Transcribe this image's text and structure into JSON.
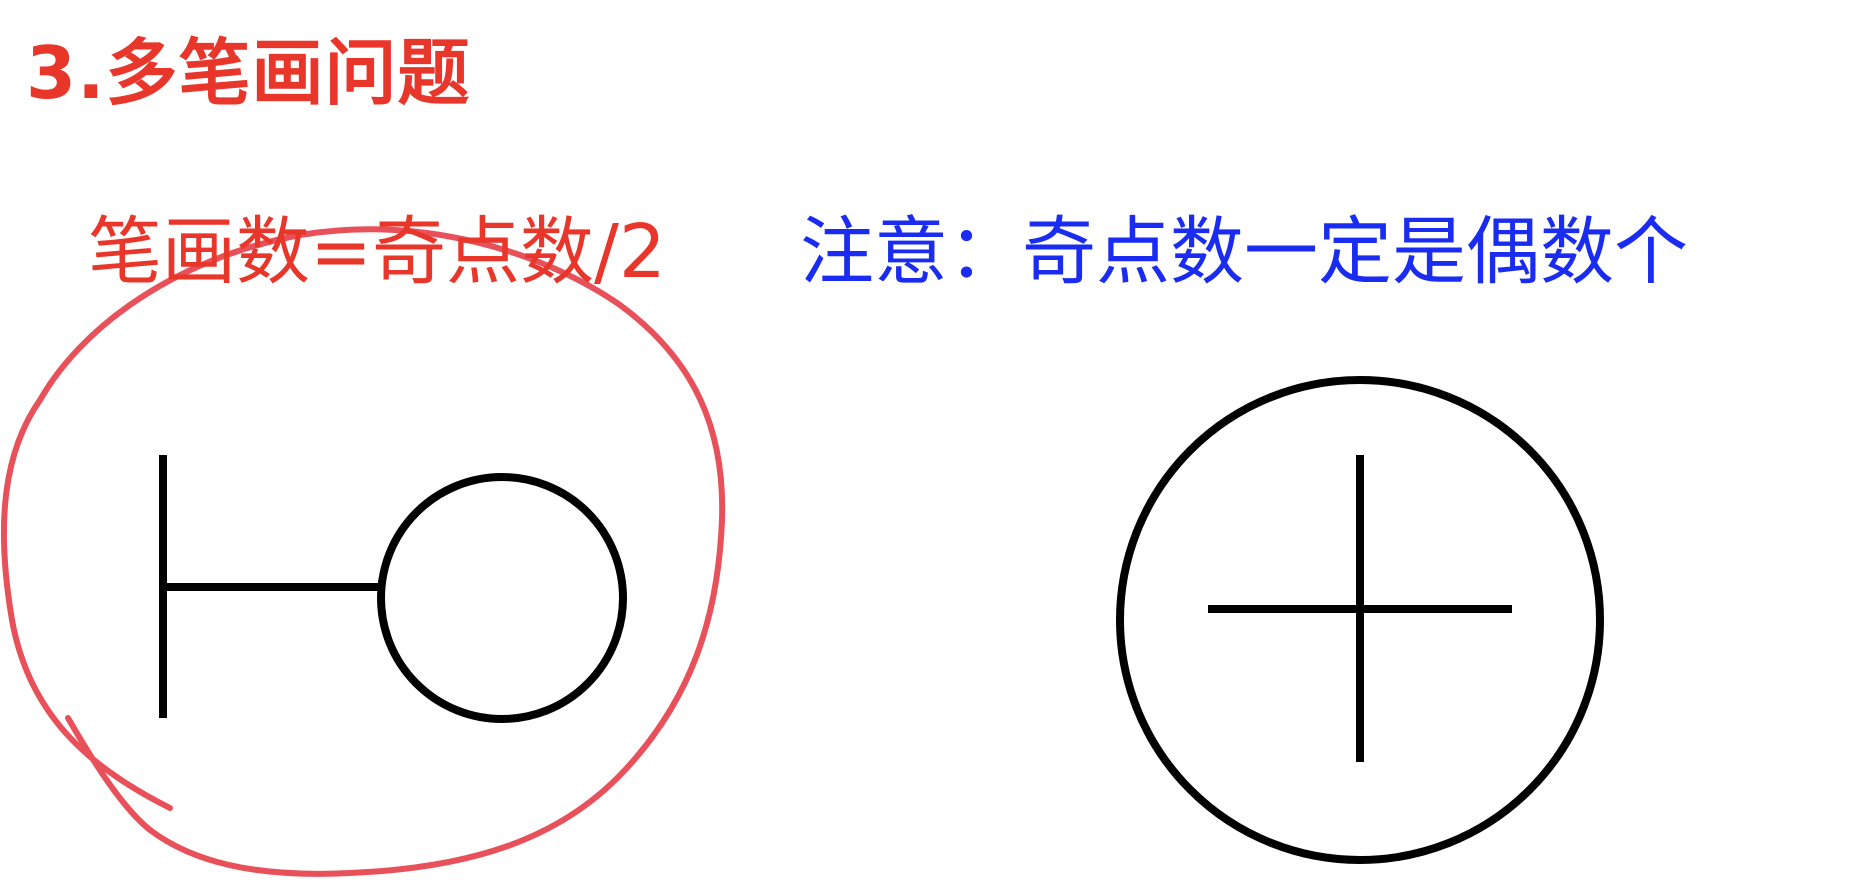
{
  "title": "3.多笔画问题",
  "formula": "笔画数=奇点数/2",
  "note": "注意：奇点数一定是偶数个",
  "colors": {
    "title": "#e8362b",
    "formula": "#e8362b",
    "note": "#1a2cf2",
    "figure_stroke": "#000000",
    "annotation": "#e8505a"
  }
}
